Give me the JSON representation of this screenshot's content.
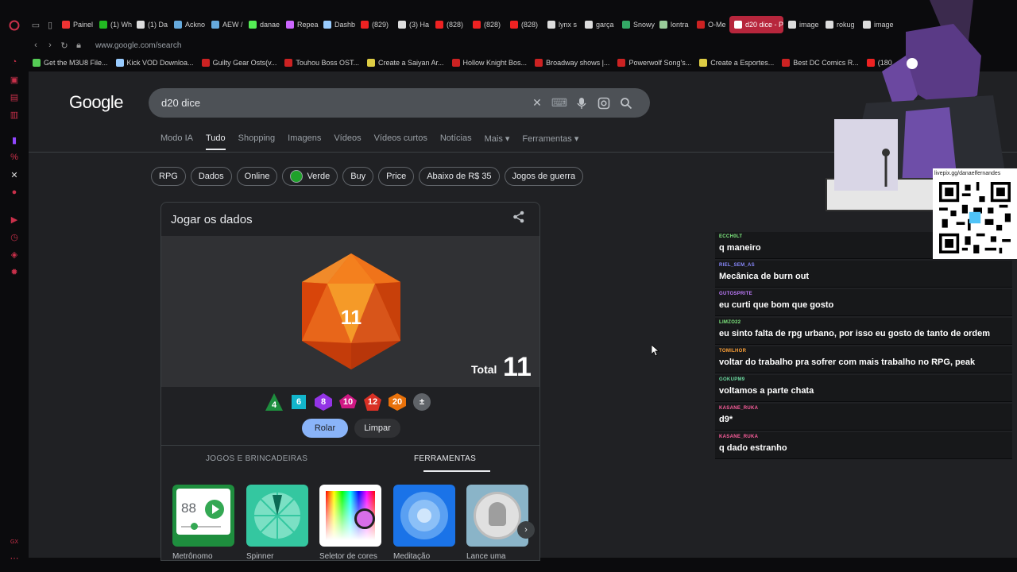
{
  "browser": {
    "tabs": [
      {
        "label": "Painel",
        "color": "#e33"
      },
      {
        "label": "(1) Wh",
        "color": "#2b2"
      },
      {
        "label": "(1) Da",
        "color": "#ddd"
      },
      {
        "label": "Ackno",
        "color": "#6ad"
      },
      {
        "label": "AEW /",
        "color": "#6ad"
      },
      {
        "label": "danae",
        "color": "#5e5"
      },
      {
        "label": "Repea",
        "color": "#c6f"
      },
      {
        "label": "Dashb",
        "color": "#9cf"
      },
      {
        "label": "(829)",
        "color": "#e22"
      },
      {
        "label": "(3) Ha",
        "color": "#ddd"
      },
      {
        "label": "(828)",
        "color": "#e22"
      },
      {
        "label": "(828)",
        "color": "#e22"
      },
      {
        "label": "(828)",
        "color": "#e22"
      },
      {
        "label": "lynx s",
        "color": "#ddd"
      },
      {
        "label": "garça",
        "color": "#ddd"
      },
      {
        "label": "Snowy",
        "color": "#3a6"
      },
      {
        "label": "lontra",
        "color": "#9c9"
      },
      {
        "label": "O-Me",
        "color": "#c22"
      },
      {
        "label": "d20 dice - P",
        "color": "#fff",
        "active": true
      },
      {
        "label": "image",
        "color": "#ddd"
      },
      {
        "label": "rokug",
        "color": "#ddd"
      },
      {
        "label": "image",
        "color": "#ddd"
      }
    ],
    "url": "www.google.com/search",
    "bookmarks": [
      {
        "label": "Get the M3U8 File...",
        "color": "#5c5"
      },
      {
        "label": "Kick VOD Downloa...",
        "color": "#9cf"
      },
      {
        "label": "Guilty Gear Osts(v...",
        "color": "#c22"
      },
      {
        "label": "Touhou Boss OST...",
        "color": "#c22"
      },
      {
        "label": "Create a Saiyan Ar...",
        "color": "#dc4"
      },
      {
        "label": "Hollow Knight Bos...",
        "color": "#c22"
      },
      {
        "label": "Broadway shows |...",
        "color": "#c22"
      },
      {
        "label": "Powerwolf Song's...",
        "color": "#c22"
      },
      {
        "label": "Create a Esportes...",
        "color": "#dc4"
      },
      {
        "label": "Best DC Comics R...",
        "color": "#c22"
      },
      {
        "label": "(180",
        "color": "#e22"
      }
    ]
  },
  "google": {
    "logo": "Google",
    "query": "d20 dice",
    "tabs": [
      "Modo IA",
      "Tudo",
      "Shopping",
      "Imagens",
      "Vídeos",
      "Vídeos curtos",
      "Notícias",
      "Mais ▾",
      "Ferramentas ▾"
    ],
    "active_tab": "Tudo",
    "chips": [
      "RPG",
      "Dados",
      "Online",
      "Verde",
      "Buy",
      "Price",
      "Abaixo de R$ 35",
      "Jogos de guerra"
    ],
    "card": {
      "title": "Jogar os dados",
      "die_value": "11",
      "total_label": "Total",
      "total_value": "11",
      "dice": [
        {
          "label": "4",
          "color": "#1e8e3e",
          "shape": "triangle"
        },
        {
          "label": "6",
          "color": "#12b5cb",
          "shape": "square"
        },
        {
          "label": "8",
          "color": "#9334e6",
          "shape": "diamond"
        },
        {
          "label": "10",
          "color": "#d01884",
          "shape": "kite"
        },
        {
          "label": "12",
          "color": "#d93025",
          "shape": "pentagon"
        },
        {
          "label": "20",
          "color": "#e8710a",
          "shape": "hexagon"
        },
        {
          "label": "±",
          "color": "#5f6368",
          "shape": "circle"
        }
      ],
      "roll_label": "Rolar",
      "clear_label": "Limpar",
      "section_left": "JOGOS E BRINCADEIRAS",
      "section_right": "FERRAMENTAS",
      "tools": [
        {
          "label": "Metrônomo",
          "bpm": "88"
        },
        {
          "label": "Spinner"
        },
        {
          "label": "Seletor de cores"
        },
        {
          "label": "Meditação"
        },
        {
          "label": "Lance uma"
        }
      ]
    }
  },
  "chat": {
    "messages": [
      {
        "user": "ECCH0LT",
        "text": "q maneiro",
        "color": "#7ee87e"
      },
      {
        "user": "RIEL_SEM_AS",
        "text": "Mecânica de burn out",
        "color": "#8a8aff"
      },
      {
        "user": "GUTOSPRITE",
        "text": "eu curti que bom que gosto",
        "color": "#c07cff"
      },
      {
        "user": "LIMZO22",
        "text": "eu sinto falta de rpg urbano, por isso eu gosto de tanto de ordem",
        "color": "#7ee87e"
      },
      {
        "user": "TOMILHOR",
        "text": "voltar do trabalho pra sofrer com mais trabalho no RPG, peak",
        "color": "#ffa238"
      },
      {
        "user": "GOKUPM9",
        "text": "voltamos a parte chata",
        "color": "#6bd9a0"
      },
      {
        "user": "KASANE_RUKA",
        "text": "d9*",
        "color": "#ff5f9e"
      },
      {
        "user": "KASANE_RUKA",
        "text": "q dado estranho",
        "color": "#ff5f9e"
      }
    ]
  },
  "overlay": {
    "qr_url": "livepix.gg/danaelfernandes"
  }
}
